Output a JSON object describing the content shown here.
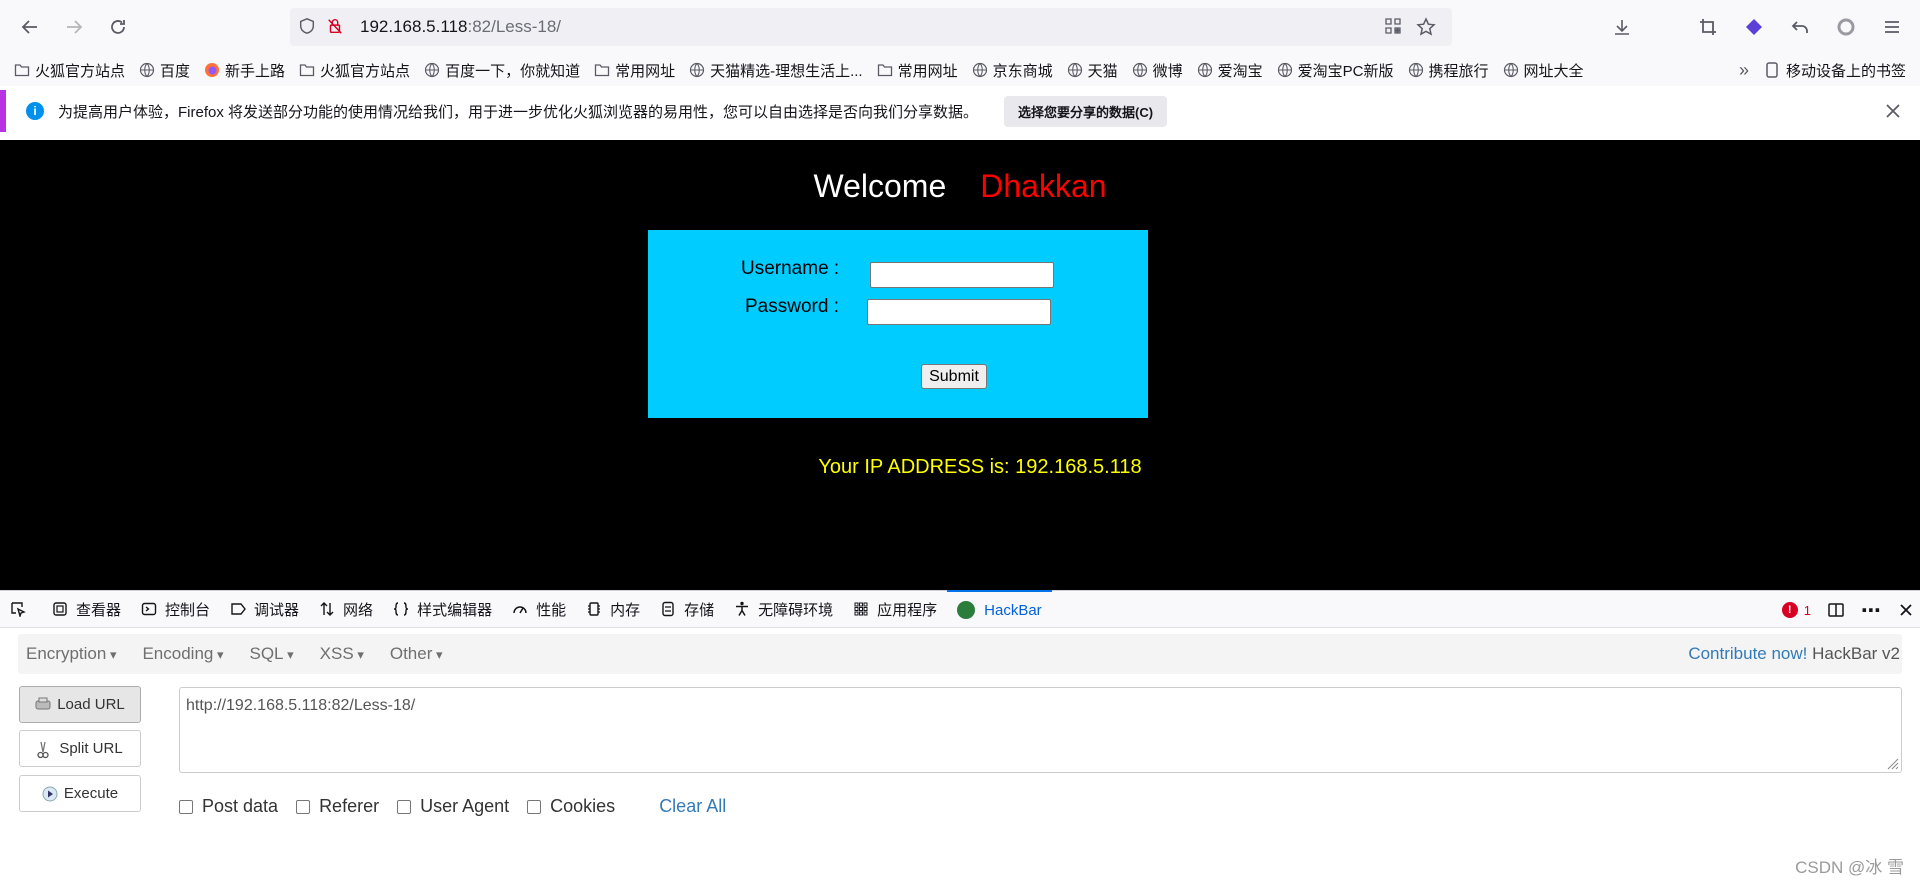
{
  "browser": {
    "url_host": "192.168.5.118",
    "url_path": ":82/Less-18/"
  },
  "bookmarks": [
    {
      "label": "火狐官方站点",
      "icon": "folder-icon"
    },
    {
      "label": "百度",
      "icon": "globe-icon"
    },
    {
      "label": "新手上路",
      "icon": "firefox-icon"
    },
    {
      "label": "火狐官方站点",
      "icon": "folder-icon"
    },
    {
      "label": "百度一下，你就知道",
      "icon": "globe-icon"
    },
    {
      "label": "常用网址",
      "icon": "folder-icon"
    },
    {
      "label": "天猫精选-理想生活上...",
      "icon": "globe-icon"
    },
    {
      "label": "常用网址",
      "icon": "folder-icon"
    },
    {
      "label": "京东商城",
      "icon": "globe-icon"
    },
    {
      "label": "天猫",
      "icon": "globe-icon"
    },
    {
      "label": "微博",
      "icon": "globe-icon"
    },
    {
      "label": "爱淘宝",
      "icon": "globe-icon"
    },
    {
      "label": "爱淘宝PC新版",
      "icon": "globe-icon"
    },
    {
      "label": "携程旅行",
      "icon": "globe-icon"
    },
    {
      "label": "网址大全",
      "icon": "globe-icon"
    }
  ],
  "bookmarks_mobile": "移动设备上的书签",
  "notification": {
    "text": "为提高用户体验，Firefox 将发送部分功能的使用情况给我们，用于进一步优化火狐浏览器的易用性，您可以自由选择是否向我们分享数据。",
    "button": "选择您要分享的数据(C)"
  },
  "page": {
    "welcome": "Welcome",
    "name": "Dhakkan",
    "username_label": "Username :",
    "password_label": "Password :",
    "submit": "Submit",
    "ip_line": "Your IP ADDRESS is: 192.168.5.118"
  },
  "devtools": {
    "tabs": [
      {
        "label": "查看器",
        "icon": "inspector-icon"
      },
      {
        "label": "控制台",
        "icon": "console-icon"
      },
      {
        "label": "调试器",
        "icon": "debugger-icon"
      },
      {
        "label": "网络",
        "icon": "network-icon"
      },
      {
        "label": "样式编辑器",
        "icon": "style-editor-icon"
      },
      {
        "label": "性能",
        "icon": "performance-icon"
      },
      {
        "label": "内存",
        "icon": "memory-icon"
      },
      {
        "label": "存储",
        "icon": "storage-icon"
      },
      {
        "label": "无障碍环境",
        "icon": "accessibility-icon"
      },
      {
        "label": "应用程序",
        "icon": "application-icon"
      }
    ],
    "active_tab": "HackBar",
    "error_count": "1"
  },
  "hackbar": {
    "menus": [
      "Encryption",
      "Encoding",
      "SQL",
      "XSS",
      "Other"
    ],
    "contribute": "Contribute now!",
    "version": "HackBar v2",
    "load_url": "Load URL",
    "split_url": "Split URL",
    "execute": "Execute",
    "url_value": "http://192.168.5.118:82/Less-18/",
    "checkboxes": [
      "Post data",
      "Referer",
      "User Agent",
      "Cookies"
    ],
    "clear_all": "Clear All"
  },
  "watermark": "CSDN @冰 雪",
  "colors": {
    "page_bg": "#000000",
    "login_box": "#00ccff",
    "welcome_name": "#ff0000",
    "ip_text": "#ffff00",
    "accent": "#0060df"
  }
}
